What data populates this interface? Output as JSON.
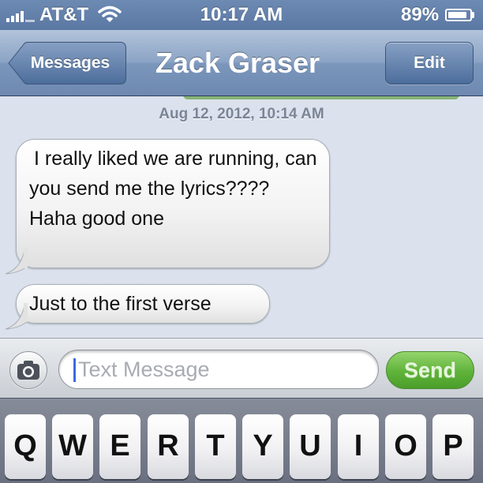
{
  "status_bar": {
    "carrier": "AT&T",
    "time": "10:17 AM",
    "battery": "89%",
    "battery_level": 0.89,
    "signal_icon": "signal-bars-icon",
    "wifi_icon": "wifi-icon",
    "battery_icon": "battery-icon"
  },
  "nav": {
    "back_label": "Messages",
    "title": "Zack Graser",
    "edit_label": "Edit"
  },
  "conversation": {
    "timestamp": "Aug 12, 2012, 10:14 AM",
    "messages": [
      {
        "text": "I really liked we are running, can you send me the lyrics???? Haha good one"
      },
      {
        "text": "Just to the first verse"
      }
    ]
  },
  "compose": {
    "camera_icon": "camera-icon",
    "placeholder": "Text Message",
    "send_label": "Send"
  },
  "keyboard": {
    "keys": [
      "Q",
      "W",
      "E",
      "R",
      "T",
      "Y",
      "U",
      "I",
      "O",
      "P"
    ]
  },
  "colors": {
    "nav_blue": "#6d89b1",
    "background": "#dbe2ed",
    "send_green": "#5fb33a",
    "cursor_blue": "#3a6be0"
  }
}
